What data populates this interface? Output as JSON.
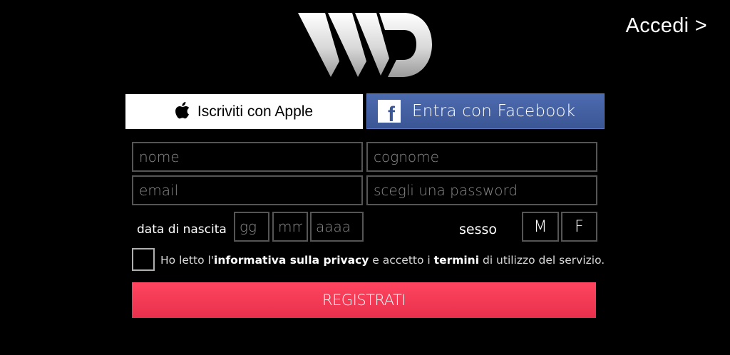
{
  "header": {
    "login_link": "Accedi >"
  },
  "social": {
    "apple_label": "Iscriviti con Apple",
    "facebook_label": "Entra con Facebook",
    "facebook_color": "#3b5694"
  },
  "form": {
    "name_placeholder": "nome",
    "surname_placeholder": "cognome",
    "email_placeholder": "email",
    "password_placeholder": "scegli una password",
    "birthdate_label": "data di nascita",
    "day_placeholder": "gg",
    "month_placeholder": "mm",
    "year_placeholder": "aaaa",
    "sex_label": "sesso",
    "sex_male": "M",
    "sex_female": "F"
  },
  "consent": {
    "text_1": "Ho letto l'",
    "privacy_link": "informativa sulla privacy",
    "text_2": " e accetto i ",
    "terms_link": "termini",
    "text_3": " di utilizzo del servizio."
  },
  "register_button": "REGISTRATI",
  "colors": {
    "background": "#000000",
    "register": "#ff3d5a",
    "field_border": "#555555"
  }
}
